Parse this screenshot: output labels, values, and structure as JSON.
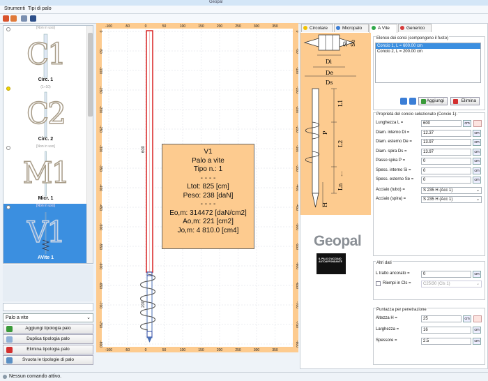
{
  "window": {
    "title": "Geopal"
  },
  "menu": {
    "items": [
      "Strumenti",
      "Tipi di palo"
    ]
  },
  "pile_types": [
    {
      "big": "C1",
      "name": "Circ. 1",
      "sub": "[Non in uso]",
      "sub2": ""
    },
    {
      "big": "C2",
      "name": "Circ. 2",
      "sub": "(1÷10)",
      "sub2": ""
    },
    {
      "big": "M1",
      "name": "Micr. 1",
      "sub": "[Non in uso]",
      "sub2": ""
    },
    {
      "big": "V1",
      "name": "AVite 1",
      "sub": "[Non in uso]",
      "sub2": "[Non in uso]"
    }
  ],
  "left": {
    "type_select": "Palo a vite",
    "buttons": [
      "Aggiungi tipologia palo",
      "Duplica tipologia palo",
      "Elimina tipologia palo",
      "Svuota le tipologie di palo"
    ]
  },
  "canvas": {
    "x_ticks": [
      "-100",
      "-50",
      "0",
      "50",
      "100",
      "150",
      "200",
      "250",
      "300",
      "350"
    ],
    "y_ticks": [
      "0",
      "-50",
      "-100",
      "-150",
      "-200",
      "-250",
      "-300",
      "-350",
      "-400",
      "-450",
      "-500",
      "-550",
      "-600",
      "-650",
      "-700",
      "-750",
      "-800"
    ],
    "dim_600": "600",
    "dim_200": "200"
  },
  "info": {
    "title": "V1",
    "line1": "Palo a vite",
    "line2": "Tipo n.: 1",
    "sep": "- - - -",
    "ltot": "Ltot: 825 [cm]",
    "peso": "Peso: 238 [daN]",
    "eo": "Eo,m: 314472 [daN/cm2]",
    "ao": "Ao,m: 221 [cm2]",
    "jo": "Jo,m: 4 810.0 [cm4]"
  },
  "tabs": [
    "Circolare",
    "Micropalo",
    "A Vite",
    "Generico"
  ],
  "figure": {
    "labels": [
      "Si",
      "Se",
      "Di",
      "De",
      "Ds",
      "L1",
      "P",
      "L2",
      "...",
      "Ln",
      "H"
    ]
  },
  "right": {
    "segments_title": "Elenco dei conci (compongono il fusto)",
    "segments": [
      "Concio 1, L = 600.00 cm",
      "Concio 2, L = 200.00 cm"
    ],
    "btn_add": "Aggiungi",
    "btn_del": "Elimina",
    "props_title": "Proprietà del concio selezionato (Concio 1):",
    "fields": [
      {
        "label": "Lunghezza L =",
        "value": "600",
        "unit": "cm"
      },
      {
        "label": "Diam. interno Di =",
        "value": "12.37",
        "unit": "cm"
      },
      {
        "label": "Diam. esterno De =",
        "value": "13.97",
        "unit": "cm"
      },
      {
        "label": "Diam. spira Ds =",
        "value": "13.97",
        "unit": "cm"
      },
      {
        "label": "Passo spira P =",
        "value": "0",
        "unit": "cm"
      },
      {
        "label": "Spess. interno Si =",
        "value": "0",
        "unit": "cm"
      },
      {
        "label": "Spess. esterno Se =",
        "value": "0",
        "unit": "cm"
      }
    ],
    "acc_tubo_label": "Acciaio (tubo) =",
    "acc_tubo": "S 235 H (Acc 1)",
    "acc_spira_label": "Acciaio (spira) =",
    "acc_spira": "S 235 H (Acc 1)",
    "altri_title": "Altri dati",
    "l_ancorato_label": "L tratto ancorato =",
    "l_ancorato": "0",
    "riempi_label": "Riempi in Cls =",
    "riempi": "C25/30 (Cls 1)",
    "punt_title": "Puntazza per penetrazione",
    "punt": [
      {
        "label": "Altezza H =",
        "value": "25",
        "unit": "cm"
      },
      {
        "label": "Larghezza =",
        "value": "16",
        "unit": "cm"
      },
      {
        "label": "Spessore =",
        "value": "2.5",
        "unit": "cm"
      }
    ],
    "unit": "cm"
  },
  "logo": {
    "brand": "Geopal",
    "tag": "IL PALO D'ACCIAIO AUTOAFFONDANTE"
  },
  "status": "Nessun comando attivo."
}
